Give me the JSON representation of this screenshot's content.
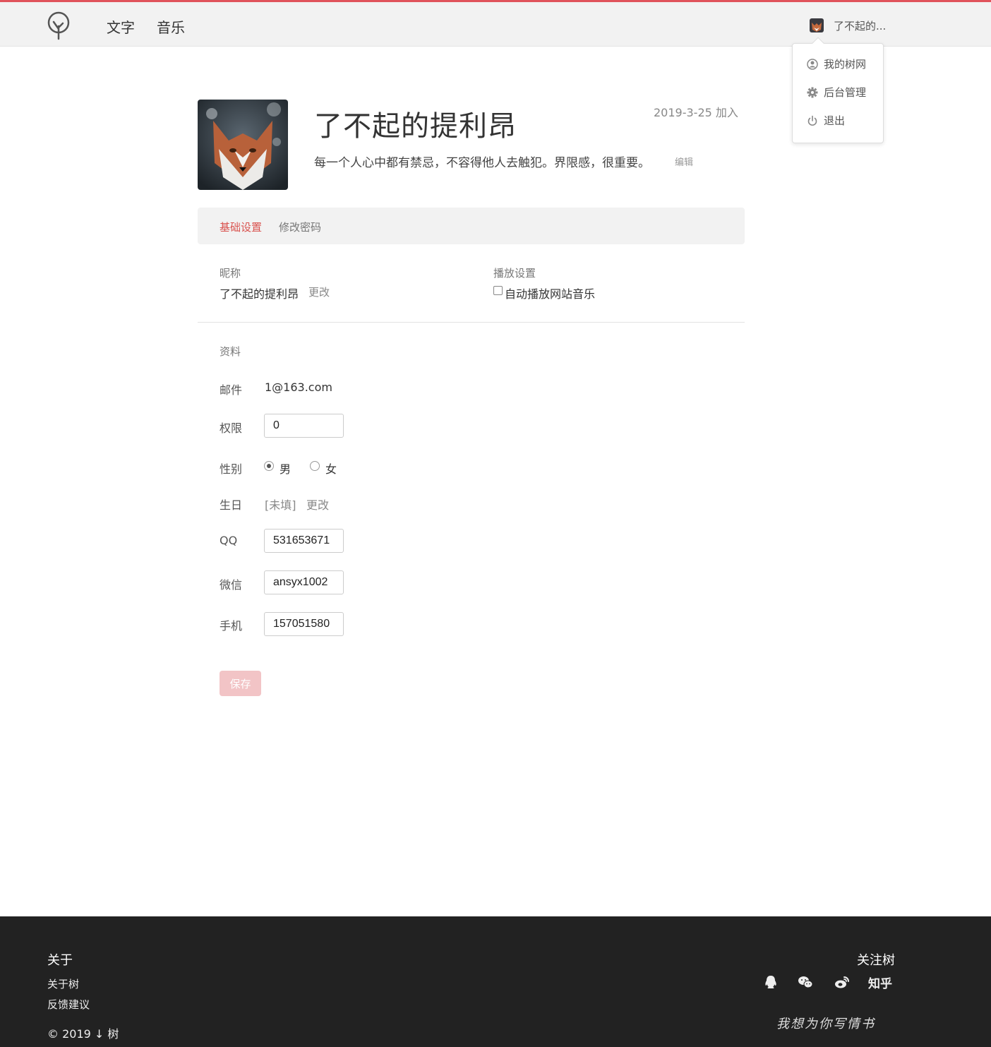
{
  "header": {
    "nav": [
      {
        "label": "文字"
      },
      {
        "label": "音乐"
      }
    ],
    "user_name": "了不起的...",
    "dropdown": [
      {
        "label": "我的树网",
        "icon": "user-circle-icon"
      },
      {
        "label": "后台管理",
        "icon": "gear-icon"
      },
      {
        "label": "退出",
        "icon": "power-icon"
      }
    ],
    "accent_color": "#e0535b"
  },
  "profile": {
    "name": "了不起的提利昂",
    "join_date": "2019-3-25 加入",
    "signature": "每一个人心中都有禁忌，不容得他人去触犯。界限感，很重要。",
    "edit_label": "编辑"
  },
  "tabs": [
    {
      "label": "基础设置",
      "active": true
    },
    {
      "label": "修改密码",
      "active": false
    }
  ],
  "basic": {
    "nickname_label": "昵称",
    "nickname": "了不起的提利昂",
    "change_label": "更改",
    "play_label": "播放设置",
    "autoplay_label": "自动播放网站音乐",
    "autoplay_checked": false
  },
  "profile_form": {
    "section_label": "资料",
    "email_label": "邮件",
    "email": "1@163.com",
    "permission_label": "权限",
    "permission": "0",
    "gender_label": "性别",
    "gender_options": [
      "男",
      "女"
    ],
    "gender_selected": "男",
    "birthday_label": "生日",
    "birthday": "[未填]",
    "birthday_change": "更改",
    "qq_label": "QQ",
    "qq": "531653671",
    "wechat_label": "微信",
    "wechat": "ansyx1002",
    "phone_label": "手机",
    "phone": "157051580",
    "save_label": "保存"
  },
  "footer": {
    "about_title": "关于",
    "links": [
      "关于树",
      "反馈建议"
    ],
    "copyright": "© 2019 ↓ 树",
    "follow_title": "关注树",
    "social": [
      "qq-icon",
      "wechat-icon",
      "weibo-icon"
    ],
    "zhihu": "知乎",
    "slogan": "我想为你写情书"
  }
}
